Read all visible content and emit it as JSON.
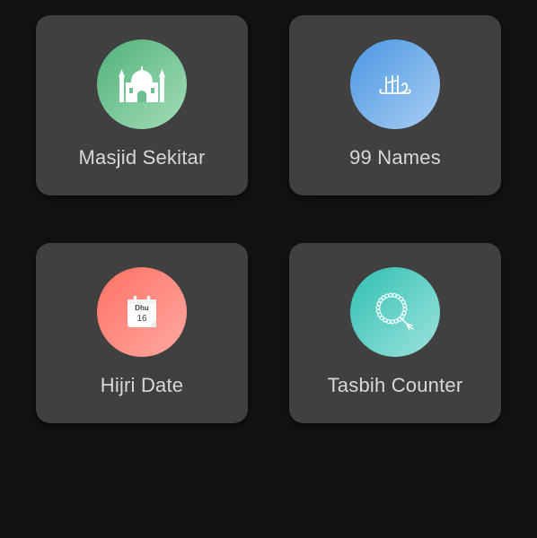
{
  "cards": [
    {
      "label": "Masjid Sekitar",
      "icon": "mosque-icon",
      "gradient": [
        "#4fb37a",
        "#a6dcb8"
      ]
    },
    {
      "label": "99 Names",
      "icon": "allah-calligraphy-icon",
      "gradient": [
        "#4a97e3",
        "#a9cdf3"
      ]
    },
    {
      "label": "Hijri Date",
      "icon": "calendar-icon",
      "gradient": [
        "#ff6f63",
        "#ffaaa2"
      ],
      "calendar": {
        "month": "Dhu",
        "day": "16"
      }
    },
    {
      "label": "Tasbih Counter",
      "icon": "prayer-beads-icon",
      "gradient": [
        "#2fc0b3",
        "#9fe3dc"
      ]
    }
  ],
  "colors": {
    "background": "#121212",
    "card": "#404040",
    "label": "#d8d8d8"
  }
}
